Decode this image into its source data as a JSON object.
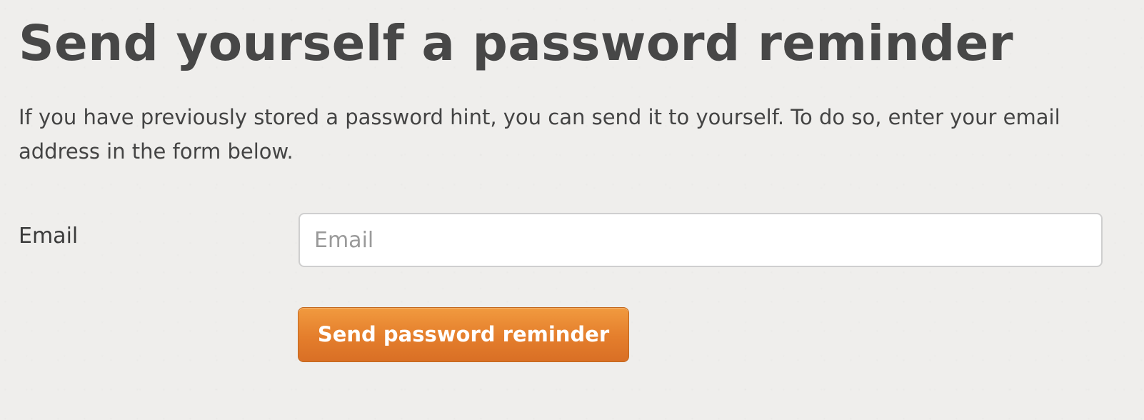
{
  "page": {
    "title": "Send yourself a password reminder",
    "intro": "If you have previously stored a password hint, you can send it to yourself. To do so, enter your email address in the form below."
  },
  "form": {
    "email_label": "Email",
    "email_placeholder": "Email",
    "email_value": "",
    "submit_label": "Send password reminder"
  },
  "colors": {
    "background": "#efeeec",
    "title_text": "#474747",
    "button_accent": "#e47e2c",
    "button_text": "#ffffff"
  }
}
